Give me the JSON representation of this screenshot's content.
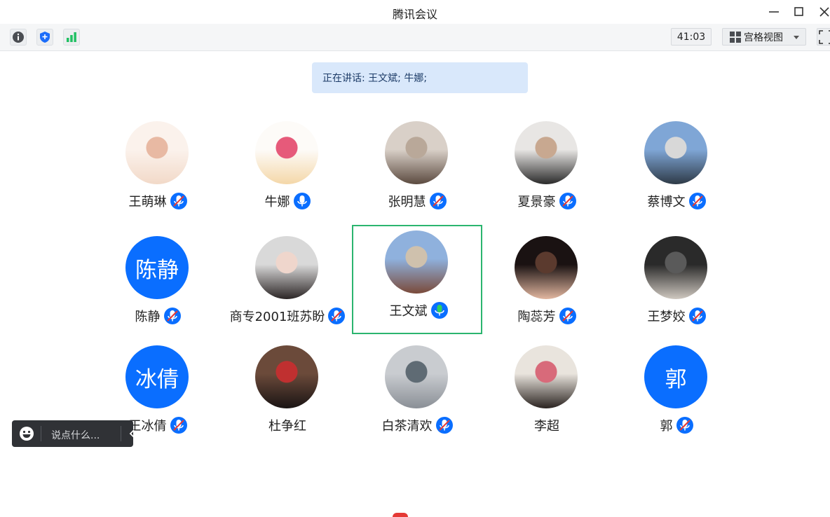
{
  "window": {
    "title": "腾讯会议"
  },
  "toolbar": {
    "icons": [
      "info-icon",
      "shield-icon",
      "signal-icon"
    ],
    "timer": "41:03",
    "view_label": "宫格视图"
  },
  "banner": {
    "speaking_text": "正在讲话: 王文斌; 牛娜;"
  },
  "participants": [
    {
      "name": "王萌琳",
      "avatar": "photo",
      "mic": "muted"
    },
    {
      "name": "牛娜",
      "avatar": "photo",
      "mic": "on"
    },
    {
      "name": "张明慧",
      "avatar": "photo",
      "mic": "muted"
    },
    {
      "name": "夏景豪",
      "avatar": "photo",
      "mic": "muted"
    },
    {
      "name": "蔡博文",
      "avatar": "photo",
      "mic": "muted"
    },
    {
      "name": "陈静",
      "avatar": "initials",
      "initials": "陈静",
      "mic": "muted"
    },
    {
      "name": "商专2001班苏盼",
      "avatar": "photo",
      "mic": "muted"
    },
    {
      "name": "王文斌",
      "avatar": "photo",
      "mic": "speaking",
      "active": true
    },
    {
      "name": "陶蕊芳",
      "avatar": "photo",
      "mic": "muted"
    },
    {
      "name": "王梦姣",
      "avatar": "photo",
      "mic": "muted"
    },
    {
      "name": "王冰倩",
      "avatar": "initials",
      "initials": "冰倩",
      "mic": "muted"
    },
    {
      "name": "杜争红",
      "avatar": "photo",
      "mic": "none"
    },
    {
      "name": "白茶清欢",
      "avatar": "photo",
      "mic": "muted"
    },
    {
      "name": "李超",
      "avatar": "photo",
      "mic": "none"
    },
    {
      "name": "郭",
      "avatar": "initials",
      "initials": "郭",
      "mic": "muted"
    }
  ],
  "chat": {
    "placeholder": "说点什么..."
  },
  "colors": {
    "accent": "#0a6eff",
    "active_border": "#2bb56f",
    "speaking_green": "#2fd15c",
    "banner_bg": "#d9e8fb"
  }
}
